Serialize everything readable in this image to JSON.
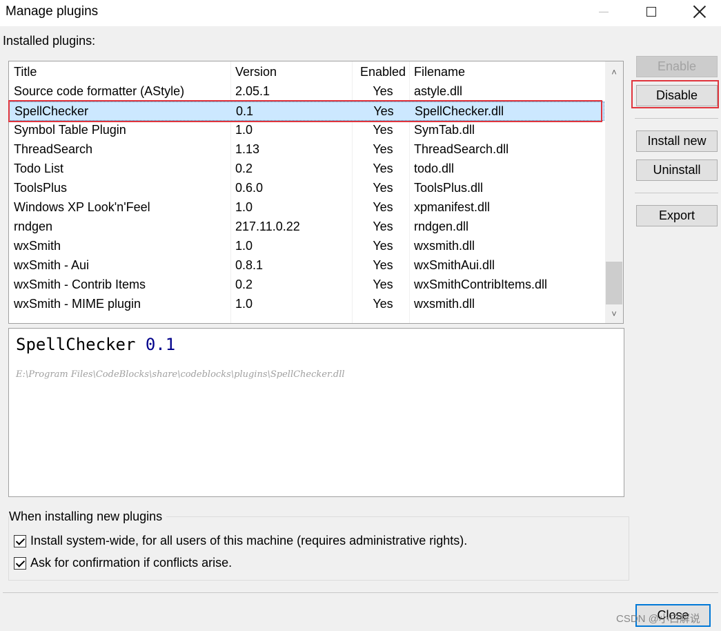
{
  "window": {
    "title": "Manage plugins"
  },
  "installed_label": "Installed plugins:",
  "columns": {
    "title": "Title",
    "version": "Version",
    "enabled": "Enabled",
    "filename": "Filename"
  },
  "plugins": [
    {
      "title": "Source code formatter (AStyle)",
      "version": "2.05.1",
      "enabled": "Yes",
      "filename": "astyle.dll"
    },
    {
      "title": "SpellChecker",
      "version": "0.1",
      "enabled": "Yes",
      "filename": "SpellChecker.dll"
    },
    {
      "title": "Symbol Table Plugin",
      "version": "1.0",
      "enabled": "Yes",
      "filename": "SymTab.dll"
    },
    {
      "title": "ThreadSearch",
      "version": "1.13",
      "enabled": "Yes",
      "filename": "ThreadSearch.dll"
    },
    {
      "title": "Todo List",
      "version": "0.2",
      "enabled": "Yes",
      "filename": "todo.dll"
    },
    {
      "title": "ToolsPlus",
      "version": "0.6.0",
      "enabled": "Yes",
      "filename": "ToolsPlus.dll"
    },
    {
      "title": "Windows XP Look'n'Feel",
      "version": "1.0",
      "enabled": "Yes",
      "filename": "xpmanifest.dll"
    },
    {
      "title": "rndgen",
      "version": "217.11.0.22",
      "enabled": "Yes",
      "filename": "rndgen.dll"
    },
    {
      "title": "wxSmith",
      "version": "1.0",
      "enabled": "Yes",
      "filename": "wxsmith.dll"
    },
    {
      "title": "wxSmith - Aui",
      "version": "0.8.1",
      "enabled": "Yes",
      "filename": "wxSmithAui.dll"
    },
    {
      "title": "wxSmith - Contrib Items",
      "version": "0.2",
      "enabled": "Yes",
      "filename": "wxSmithContribItems.dll"
    },
    {
      "title": "wxSmith - MIME plugin",
      "version": "1.0",
      "enabled": "Yes",
      "filename": "wxsmith.dll"
    }
  ],
  "selected_index": 1,
  "detail": {
    "name": "SpellChecker",
    "version": "0.1",
    "path": "E:\\Program Files\\CodeBlocks\\share\\codeblocks\\plugins\\SpellChecker.dll"
  },
  "buttons": {
    "enable": "Enable",
    "disable": "Disable",
    "install_new": "Install new",
    "uninstall": "Uninstall",
    "export": "Export",
    "close": "Close"
  },
  "install_options": {
    "label": "When installing new plugins",
    "system_wide": {
      "label": "Install system-wide, for all users of this machine (requires administrative rights).",
      "checked": true
    },
    "confirm_conflicts": {
      "label": "Ask for confirmation if conflicts arise.",
      "checked": true
    }
  },
  "watermark": "CSDN @小白解说",
  "colors": {
    "selection": "#cce8ff",
    "highlight_box": "#e0343c",
    "version_text": "#00008b"
  }
}
